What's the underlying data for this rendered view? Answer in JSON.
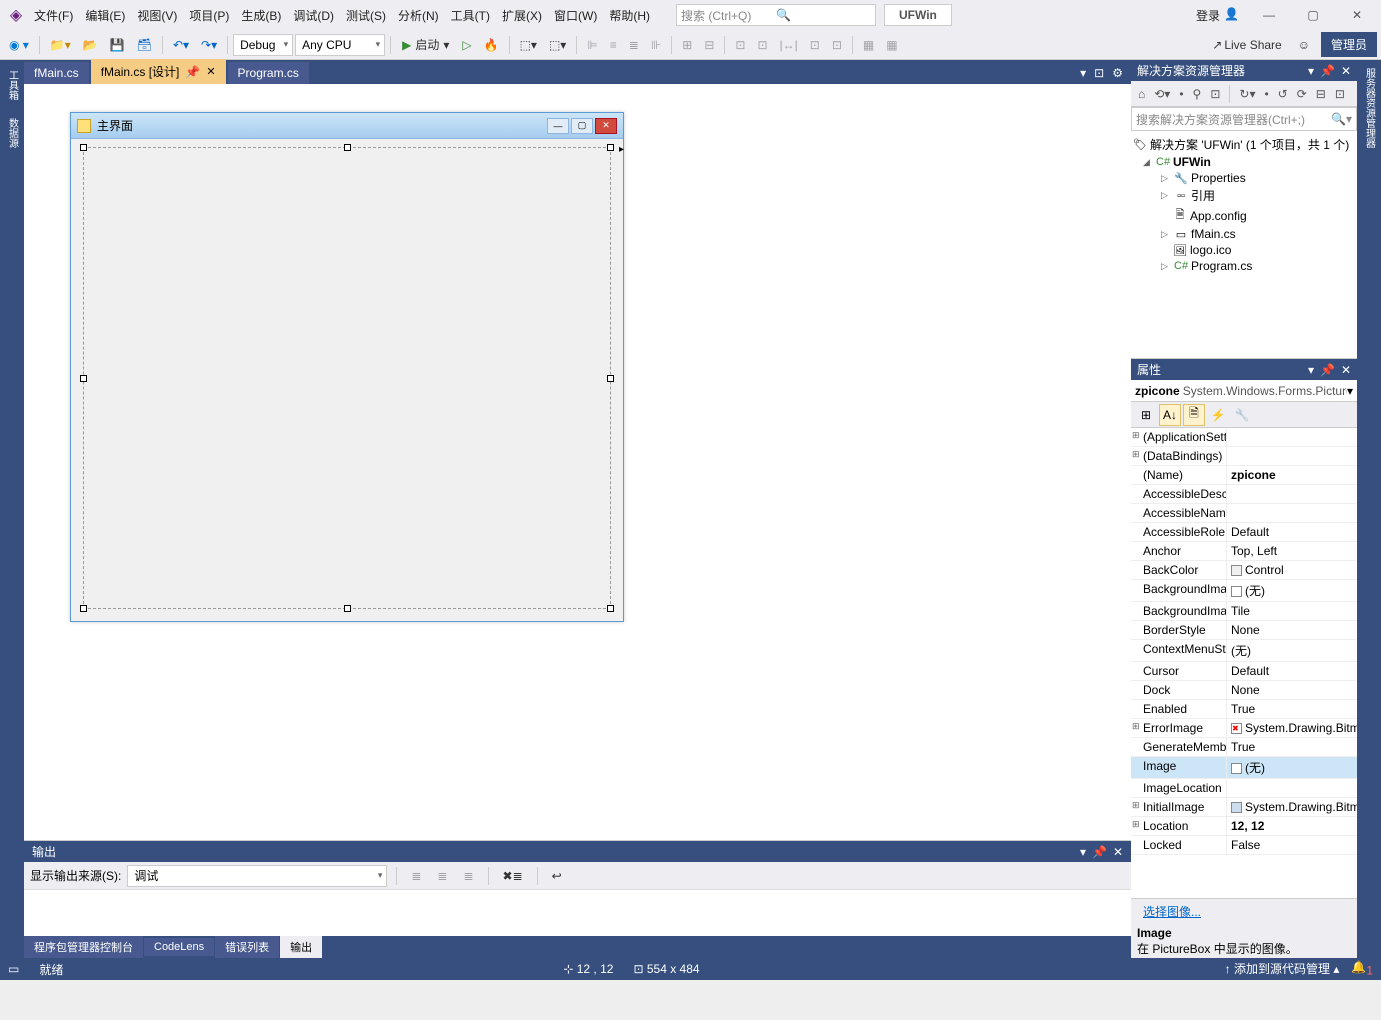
{
  "menu": [
    "文件(F)",
    "编辑(E)",
    "视图(V)",
    "项目(P)",
    "生成(B)",
    "调试(D)",
    "测试(S)",
    "分析(N)",
    "工具(T)",
    "扩展(X)",
    "窗口(W)",
    "帮助(H)"
  ],
  "search_placeholder": "搜索 (Ctrl+Q)",
  "project_name": "UFWin",
  "login": "登录",
  "admin": "管理员",
  "toolbar": {
    "config": "Debug",
    "platform": "Any CPU",
    "start": "启动",
    "liveshare": "Live Share"
  },
  "tabs": [
    {
      "label": "fMain.cs"
    },
    {
      "label": "fMain.cs [设计]",
      "active": true,
      "pinned": true
    },
    {
      "label": "Program.cs"
    }
  ],
  "form": {
    "title": "主界面"
  },
  "left_gutter": [
    "工具箱",
    "数据源"
  ],
  "right_gutter": [
    "服务器资源管理器"
  ],
  "output": {
    "title": "输出",
    "src_label": "显示输出来源(S):",
    "src_value": "调试",
    "tabs": [
      "程序包管理器控制台",
      "CodeLens",
      "错误列表",
      "输出"
    ]
  },
  "sol": {
    "title": "解决方案资源管理器",
    "search_ph": "搜索解决方案资源管理器(Ctrl+;)",
    "root": "解决方案 'UFWin' (1 个项目，共 1 个)",
    "proj": "UFWin",
    "items": [
      "Properties",
      "引用",
      "App.config",
      "fMain.cs",
      "logo.ico",
      "Program.cs"
    ]
  },
  "props": {
    "title": "属性",
    "obj_name": "zpicone",
    "obj_type": "System.Windows.Forms.PictureBox",
    "link": "选择图像...",
    "desc_title": "Image",
    "desc_text": "在 PictureBox 中显示的图像。",
    "rows": [
      {
        "n": "(ApplicationSettings)",
        "v": "",
        "exp": true
      },
      {
        "n": "(DataBindings)",
        "v": "",
        "exp": true
      },
      {
        "n": "(Name)",
        "v": "zpicone",
        "b": true
      },
      {
        "n": "AccessibleDescription",
        "v": ""
      },
      {
        "n": "AccessibleName",
        "v": ""
      },
      {
        "n": "AccessibleRole",
        "v": "Default"
      },
      {
        "n": "Anchor",
        "v": "Top, Left"
      },
      {
        "n": "BackColor",
        "v": "Control",
        "c": "#f0f0f0"
      },
      {
        "n": "BackgroundImage",
        "v": "(无)",
        "c": "#fff"
      },
      {
        "n": "BackgroundImageLayout",
        "v": "Tile"
      },
      {
        "n": "BorderStyle",
        "v": "None"
      },
      {
        "n": "ContextMenuStrip",
        "v": "(无)"
      },
      {
        "n": "Cursor",
        "v": "Default"
      },
      {
        "n": "Dock",
        "v": "None"
      },
      {
        "n": "Enabled",
        "v": "True"
      },
      {
        "n": "ErrorImage",
        "v": "System.Drawing.Bitmap",
        "exp": true,
        "ic": "x"
      },
      {
        "n": "GenerateMember",
        "v": "True"
      },
      {
        "n": "Image",
        "v": "(无)",
        "sel": true,
        "c": "#fff"
      },
      {
        "n": "ImageLocation",
        "v": ""
      },
      {
        "n": "InitialImage",
        "v": "System.Drawing.Bitmap",
        "exp": true,
        "ic": "i"
      },
      {
        "n": "Location",
        "v": "12, 12",
        "exp": true,
        "b": true
      },
      {
        "n": "Locked",
        "v": "False"
      }
    ]
  },
  "status": {
    "ready": "就绪",
    "pos": "12 , 12",
    "size": "554 x 484",
    "src": "添加到源代码管理"
  }
}
